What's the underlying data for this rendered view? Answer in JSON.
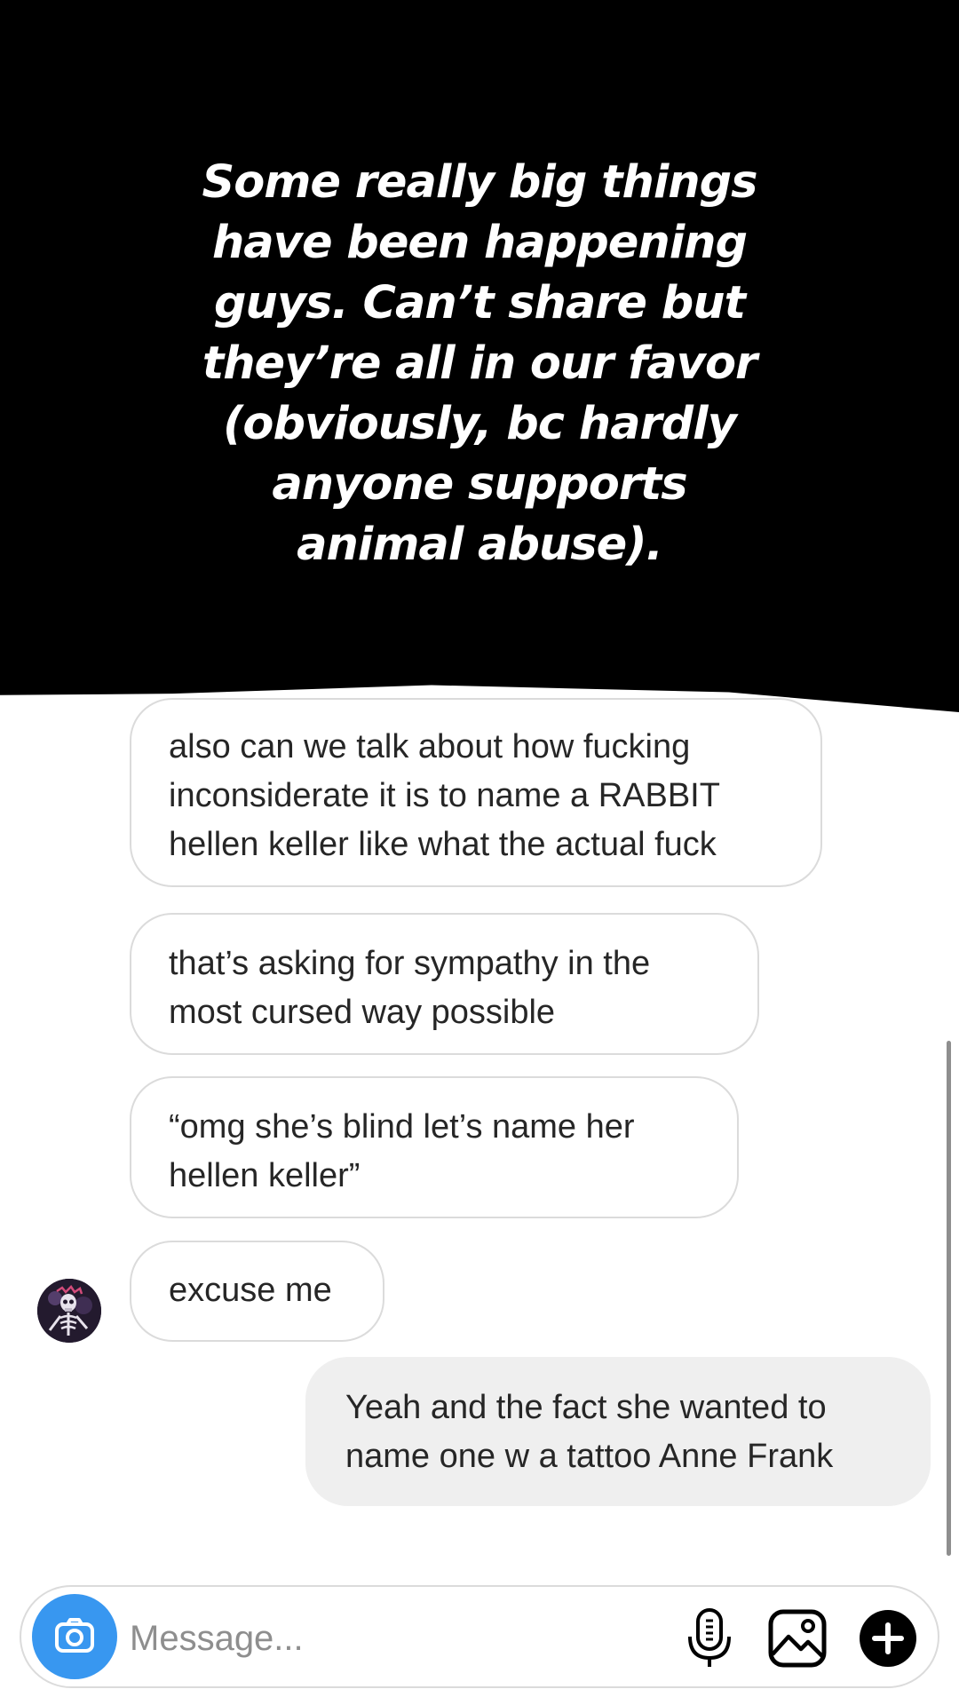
{
  "story_overlay": {
    "text": "Some really big things\nhave been happening\nguys. Can’t share but\nthey’re all in our favor\n(obviously, bc hardly\nanyone supports\nanimal abuse)."
  },
  "thread": {
    "messages": [
      {
        "direction": "incoming",
        "lines": [
          "also can we talk about how fucking",
          "inconsiderate it is to name a RABBIT",
          "hellen keller like what the actual fuck"
        ]
      },
      {
        "direction": "incoming",
        "lines": [
          "that’s asking for sympathy in the",
          "most cursed way possible"
        ]
      },
      {
        "direction": "incoming",
        "lines": [
          "“omg she’s blind let’s name her",
          "hellen keller”"
        ]
      },
      {
        "direction": "incoming",
        "lines": [
          "excuse me"
        ]
      },
      {
        "direction": "outgoing",
        "lines": [
          "Yeah and the fact she wanted to",
          "name one w a tattoo Anne Frank"
        ]
      }
    ]
  },
  "composer": {
    "placeholder": "Message...",
    "icons": [
      "camera-icon",
      "microphone-icon",
      "gallery-icon",
      "plus-icon"
    ]
  },
  "colors": {
    "accent": "#3897f0",
    "bubble_border": "#dbdbdb",
    "outgoing_bubble": "#efefef",
    "text": "#262626",
    "placeholder": "#8e8e8e"
  }
}
